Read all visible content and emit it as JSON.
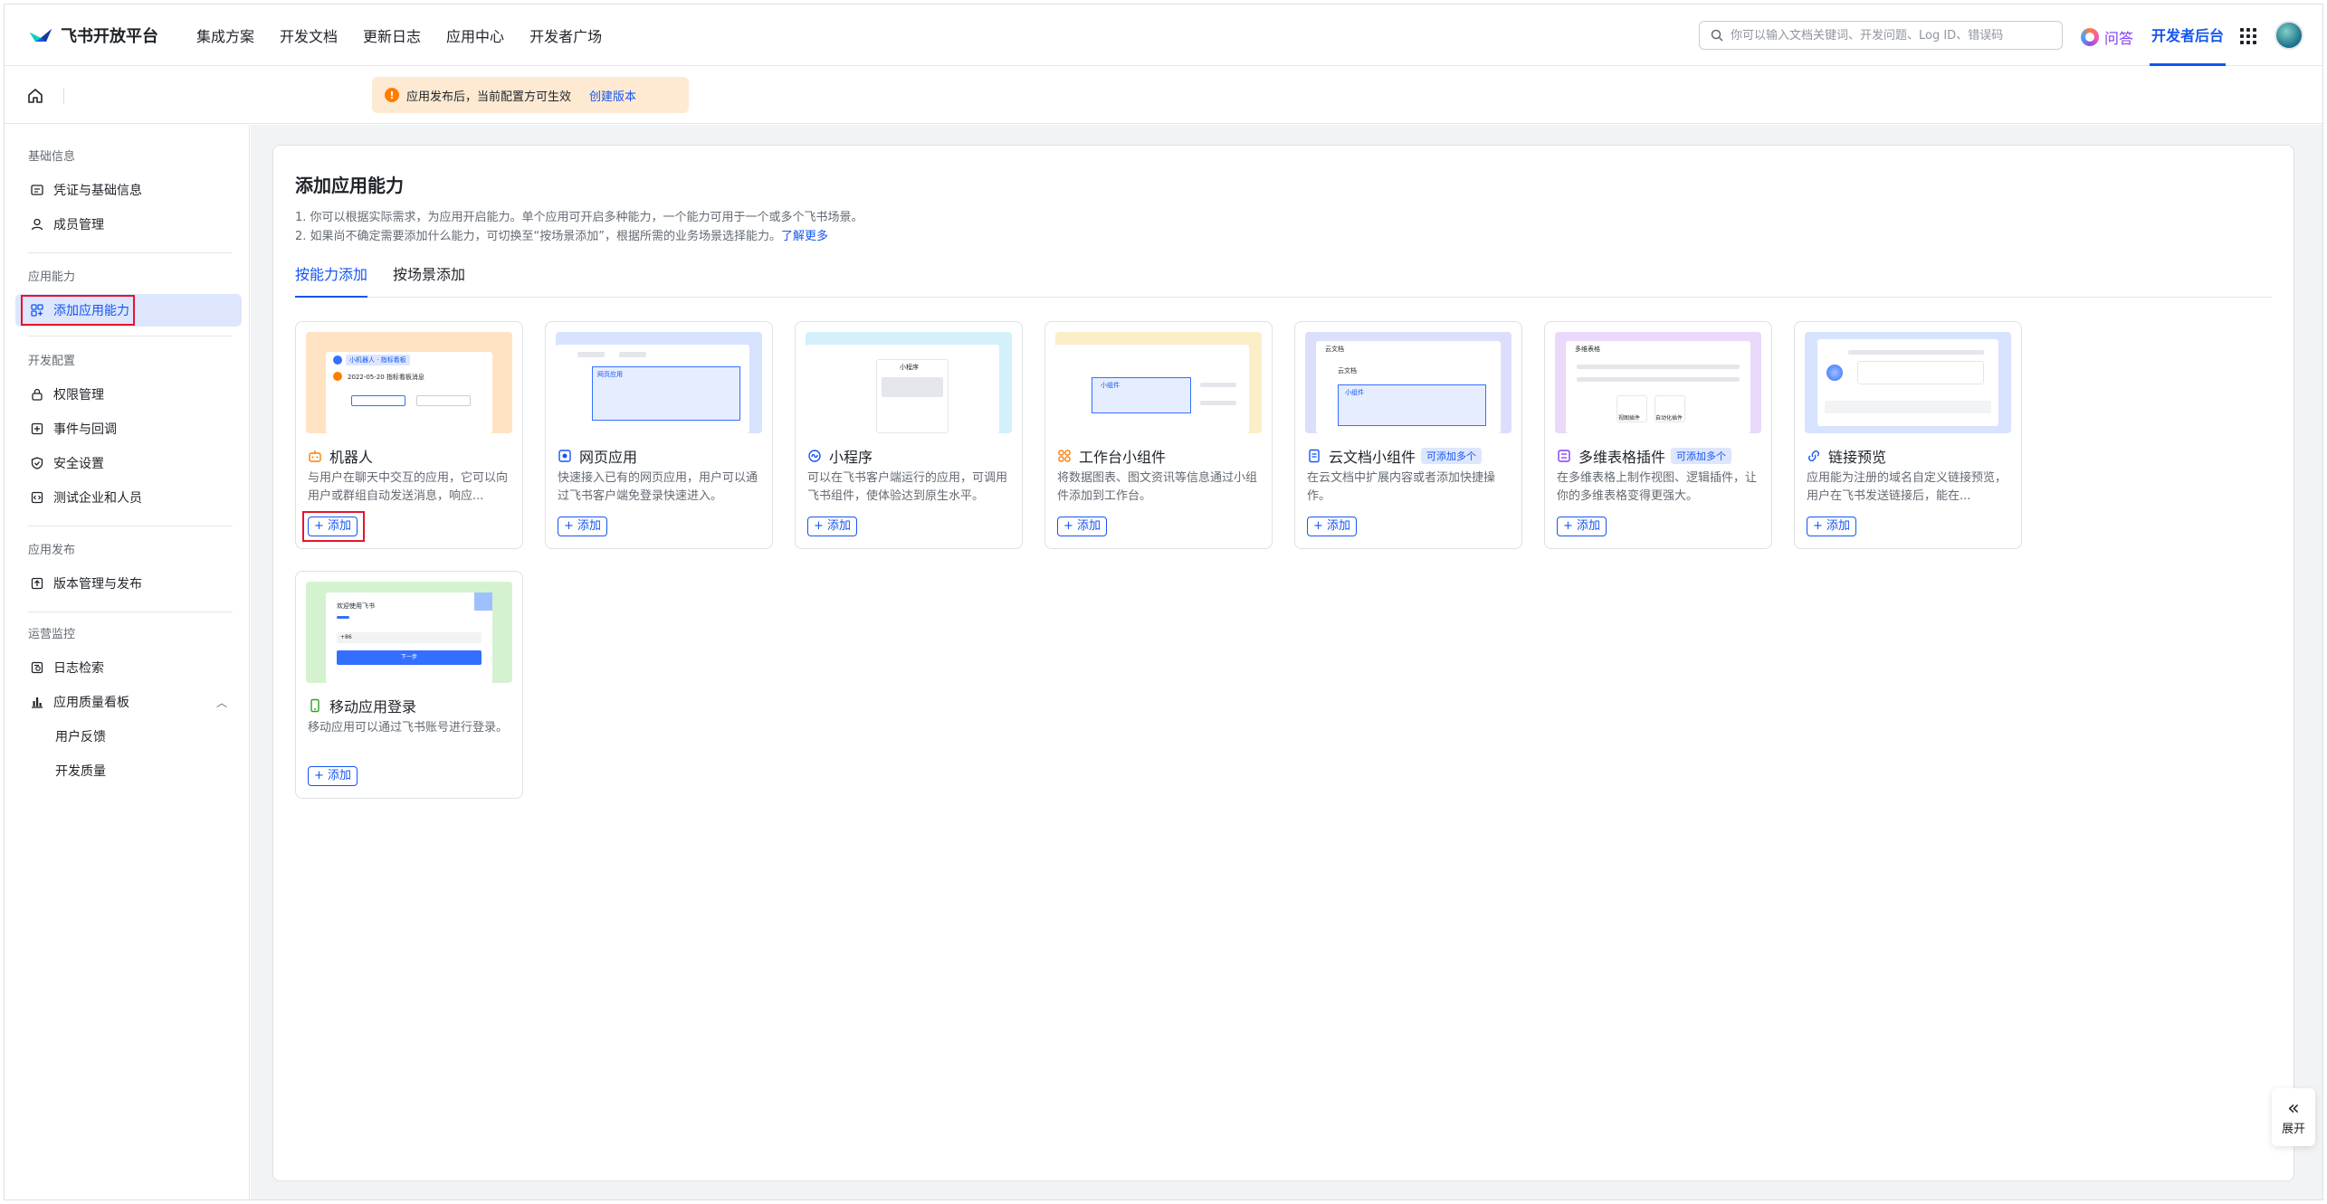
{
  "topnav": {
    "logo_text": "飞书开放平台",
    "links": [
      "集成方案",
      "开发文档",
      "更新日志",
      "应用中心",
      "开发者广场"
    ],
    "search_placeholder": "你可以输入文档关键词、开发问题、Log ID、错误码",
    "ask_label": "问答",
    "console_label": "开发者后台"
  },
  "banner": {
    "text": "应用发布后，当前配置方可生效",
    "link": "创建版本"
  },
  "sidebar": {
    "groups": {
      "basic": "基础信息",
      "capability": "应用能力",
      "config": "开发配置",
      "release": "应用发布",
      "ops": "运营监控"
    },
    "items": {
      "credentials": "凭证与基础信息",
      "members": "成员管理",
      "add_capability": "添加应用能力",
      "permissions": "权限管理",
      "events": "事件与回调",
      "security": "安全设置",
      "test_tenant": "测试企业和人员",
      "versions": "版本管理与发布",
      "logs": "日志检索",
      "quality": "应用质量看板",
      "feedback": "用户反馈",
      "dev_quality": "开发质量"
    }
  },
  "main": {
    "title": "添加应用能力",
    "desc1": "1. 你可以根据实际需求，为应用开启能力。单个应用可开启多种能力，一个能力可用于一个或多个飞书场景。",
    "desc2": "2. 如果尚不确定需要添加什么能力，可切换至“按场景添加”，根据所需的业务场景选择能力。",
    "learn_more": "了解更多",
    "tabs": [
      "按能力添加",
      "按场景添加"
    ],
    "add_label": "+ 添加",
    "multi_tag": "可添加多个",
    "cards": [
      {
        "title": "机器人",
        "desc": "与用户在聊天中交互的应用，它可以向用户或群组自动发送消息，响应..."
      },
      {
        "title": "网页应用",
        "desc": "快速接入已有的网页应用，用户可以通过飞书客户端免登录快速进入。"
      },
      {
        "title": "小程序",
        "desc": "可以在飞书客户端运行的应用，可调用飞书组件，使体验达到原生水平。"
      },
      {
        "title": "工作台小组件",
        "desc": "将数据图表、图文资讯等信息通过小组件添加到工作台。"
      },
      {
        "title": "云文档小组件",
        "desc": "在云文档中扩展内容或者添加快捷操作。"
      },
      {
        "title": "多维表格插件",
        "desc": "在多维表格上制作视图、逻辑插件，让你的多维表格变得更强大。"
      },
      {
        "title": "链接预览",
        "desc": "应用能为注册的域名自定义链接预览，用户在飞书发送链接后，能在..."
      },
      {
        "title": "移动应用登录",
        "desc": "移动应用可以通过飞书账号进行登录。"
      }
    ],
    "thumbs": {
      "bot_tag": "小机器人 · 指标看板",
      "bot_line": "2022-05-20 指标看板消息",
      "web_tab": "网页应用",
      "mini_title": "小程序",
      "widget_label": "小组件",
      "doc_title": "云文档",
      "doc_sub": "云文档",
      "doc_widget": "小组件",
      "base_title": "多维表格",
      "base_btn1": "视图插件",
      "base_btn2": "自动化插件",
      "login_title": "欢迎使用飞书",
      "login_next": "下一步",
      "login_code": "+86"
    }
  },
  "expand_label": "展开",
  "colors": {
    "accent": "#1456f0",
    "highlight": "#e5152c",
    "warning_bg": "#feead2"
  }
}
